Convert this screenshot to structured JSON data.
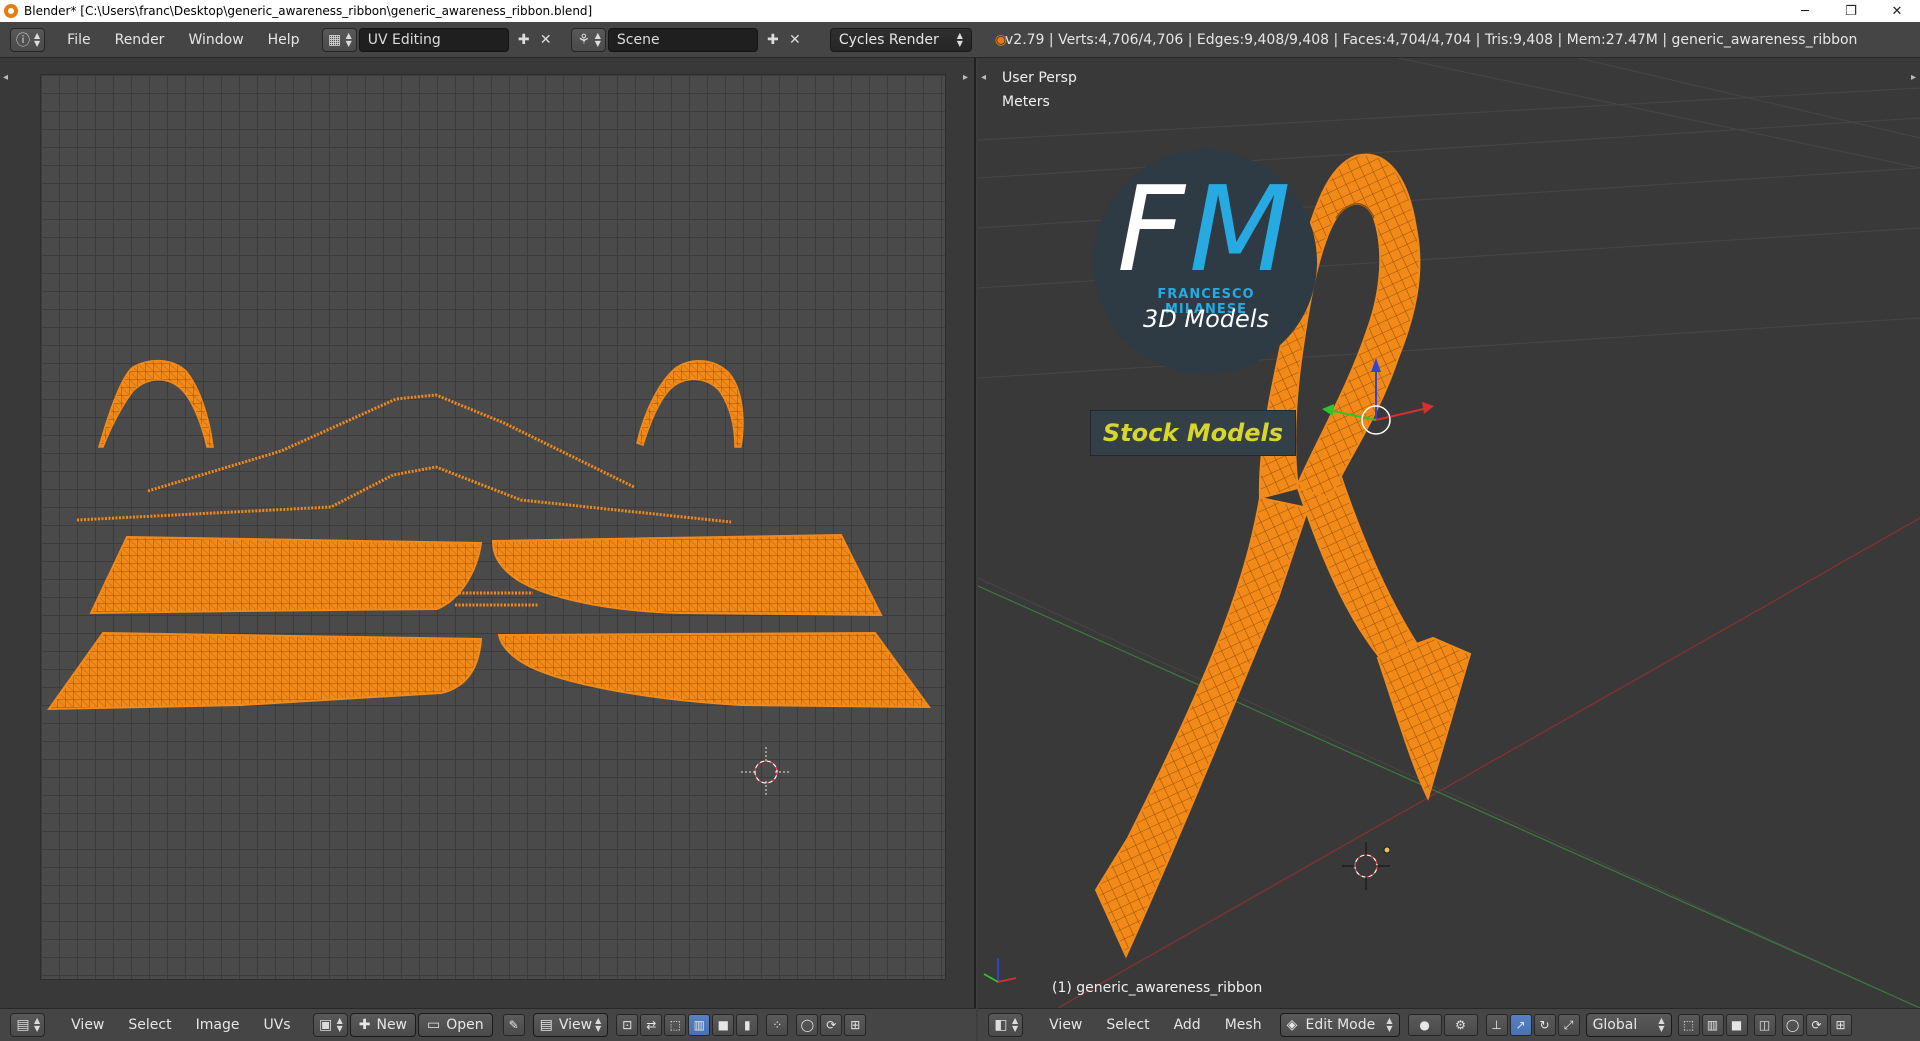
{
  "window": {
    "title": "Blender* [C:\\Users\\franc\\Desktop\\generic_awareness_ribbon\\generic_awareness_ribbon.blend]",
    "controls": {
      "minimize": "─",
      "restore": "❐",
      "close": "✕"
    }
  },
  "info_header": {
    "menus": [
      "File",
      "Render",
      "Window",
      "Help"
    ],
    "screen_layout": "UV Editing",
    "scene": "Scene",
    "render_engine": "Cycles Render",
    "stats": "v2.79 | Verts:4,706/4,706 | Edges:9,408/9,408 | Faces:4,704/4,704 | Tris:9,408 | Mem:27.47M | generic_awareness_ribbon"
  },
  "viewport": {
    "view_name": "User Persp",
    "units": "Meters",
    "object_label": "(1) generic_awareness_ribbon",
    "logo": {
      "initial_f": "F",
      "initial_m": "M",
      "brand": "FRANCESCO MILANESE",
      "subtitle": "3D Models",
      "badge": "Stock Models"
    }
  },
  "uv_bottom": {
    "menus": [
      "View",
      "Select",
      "Image",
      "UVs"
    ],
    "new_label": "New",
    "open_label": "Open",
    "view_label": "View"
  },
  "vp_bottom": {
    "menus": [
      "View",
      "Select",
      "Add",
      "Mesh"
    ],
    "mode": "Edit Mode",
    "orientation": "Global"
  },
  "colors": {
    "mesh_orange": "#f28a1a",
    "mesh_dark": "#b55e05",
    "header_bg": "#454545",
    "editor_bg": "#393939",
    "accent_blue": "#27a9e1",
    "badge_yellow": "#d8d62a"
  }
}
